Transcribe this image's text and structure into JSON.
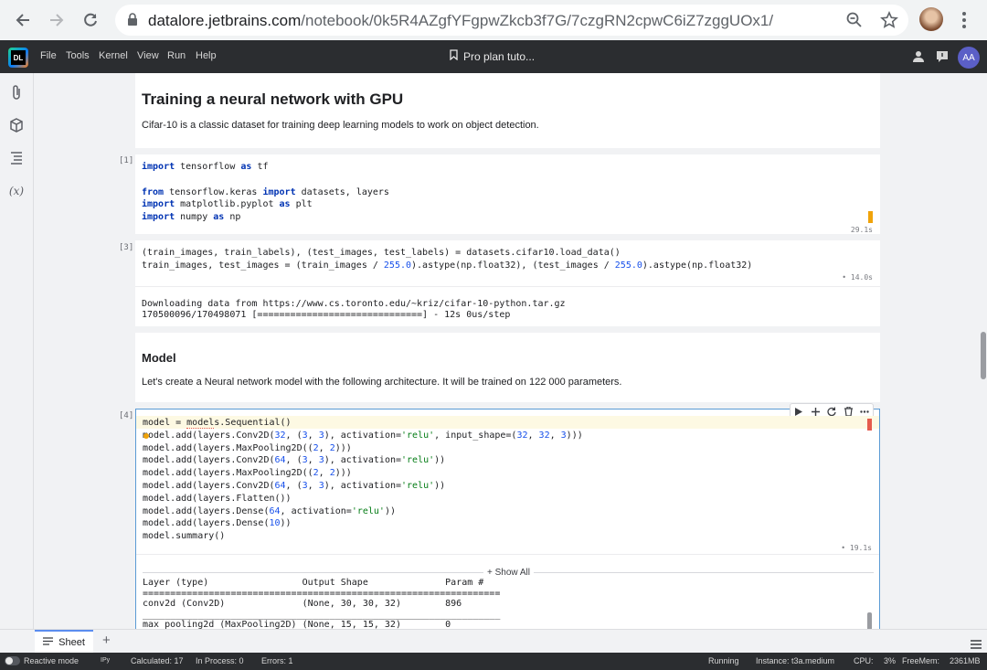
{
  "browser": {
    "url_domain": "datalore.jetbrains.com",
    "url_path": "/notebook/0k5R4AZgfYFgpwZkcb3f7G/7czgRN2cpwC6iZ7zggUOx1/"
  },
  "app": {
    "logo": "DL",
    "menu": [
      "File",
      "Tools",
      "Kernel",
      "View",
      "Run",
      "Help"
    ],
    "notebook_title": "Pro plan tuto...",
    "user_initials": "AA"
  },
  "cells": {
    "md1": {
      "title": "Training a neural network with GPU",
      "text": "Cifar-10 is a classic dataset for training deep learning models to work on object detection."
    },
    "code1": {
      "exec": "[1]",
      "timing": "29.1s"
    },
    "code2": {
      "exec": "[3]",
      "timing": "• 14.0s",
      "output": "Downloading data from https://www.cs.toronto.edu/~kriz/cifar-10-python.tar.gz\n170500096/170498071 [==============================] - 12s 0us/step"
    },
    "md2": {
      "title": "Model",
      "text": "Let's create a Neural network model with the following architecture. It will be trained on 122 000 parameters."
    },
    "code3": {
      "exec": "[4]",
      "timing": "• 19.1s",
      "show_all": "+ Show All",
      "output": "Layer (type)                 Output Shape              Param #\n=================================================================\nconv2d (Conv2D)              (None, 30, 30, 32)        896\n_________________________________________________________________\nmax_pooling2d (MaxPooling2D) (None, 15, 15, 32)        0"
    }
  },
  "bottom": {
    "sheet_tab": "Sheet",
    "add_tab": "+"
  },
  "status": {
    "reactive_mode": "Reactive mode",
    "kernel": "IPy",
    "calculated": "Calculated: 17",
    "in_process": "In Process: 0",
    "errors": "Errors: 1",
    "running": "Running",
    "instance": "Instance: t3a.medium",
    "cpu_label": "CPU:",
    "cpu_value": "3%",
    "freemem_label": "FreeMem:",
    "freemem_value": "2361MB"
  },
  "colors": {
    "keyword": "#0033b3",
    "number": "#1750eb",
    "string": "#067d17",
    "warning_marker": "#f0a30a",
    "error_marker": "#e55b4d",
    "accent": "#5b8def"
  }
}
